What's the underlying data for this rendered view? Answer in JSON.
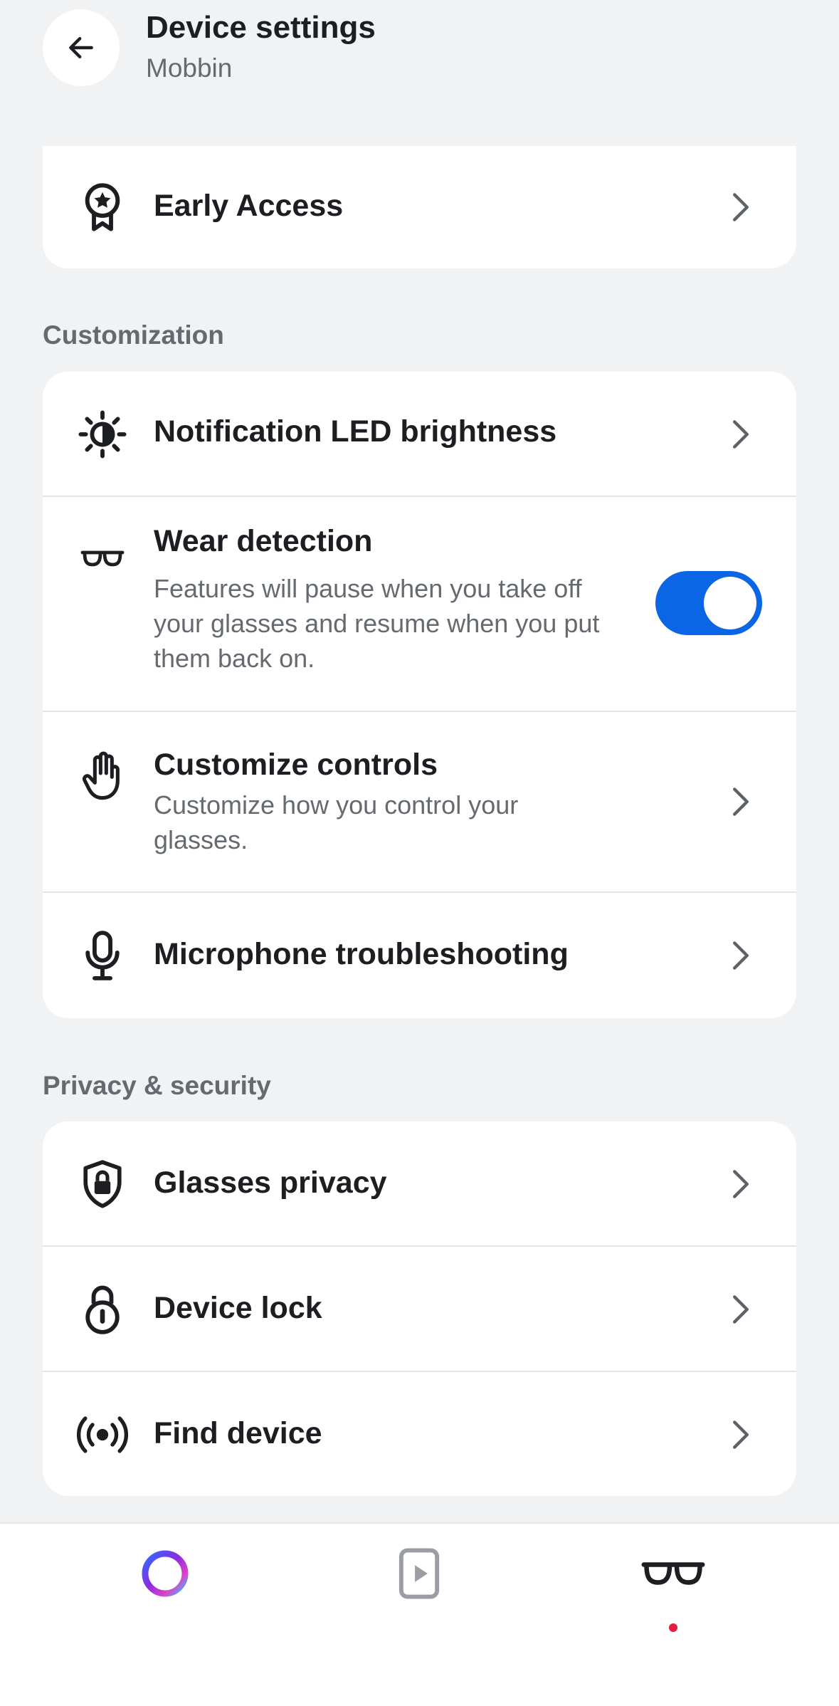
{
  "header": {
    "title": "Device settings",
    "subtitle": "Mobbin",
    "back_icon": "arrow-left-icon"
  },
  "top_card": {
    "items": [
      {
        "label": "Early Access",
        "icon": "award-ribbon-icon"
      }
    ]
  },
  "customization": {
    "section_label": "Customization",
    "items": [
      {
        "label": "Notification LED brightness",
        "icon": "brightness-icon"
      },
      {
        "label": "Wear detection",
        "description": "Features will pause when you take off your glasses and resume when you put them back on.",
        "icon": "glasses-small-icon",
        "toggle_on": true
      },
      {
        "label": "Customize controls",
        "description": "Customize how you control your glasses.",
        "icon": "hand-icon"
      },
      {
        "label": "Microphone troubleshooting",
        "icon": "microphone-icon"
      }
    ]
  },
  "privacy": {
    "section_label": "Privacy & security",
    "items": [
      {
        "label": "Glasses privacy",
        "icon": "shield-lock-icon"
      },
      {
        "label": "Device lock",
        "icon": "padlock-icon"
      },
      {
        "label": "Find device",
        "icon": "broadcast-icon"
      }
    ]
  },
  "bottom_nav": {
    "items": [
      {
        "icon": "ai-ring-icon",
        "active": false
      },
      {
        "icon": "media-play-icon",
        "active": false
      },
      {
        "icon": "glasses-icon",
        "active": true
      }
    ]
  },
  "colors": {
    "accent": "#0a66e4",
    "background": "#f1f2f4",
    "notification_dot": "#e41e3f"
  }
}
